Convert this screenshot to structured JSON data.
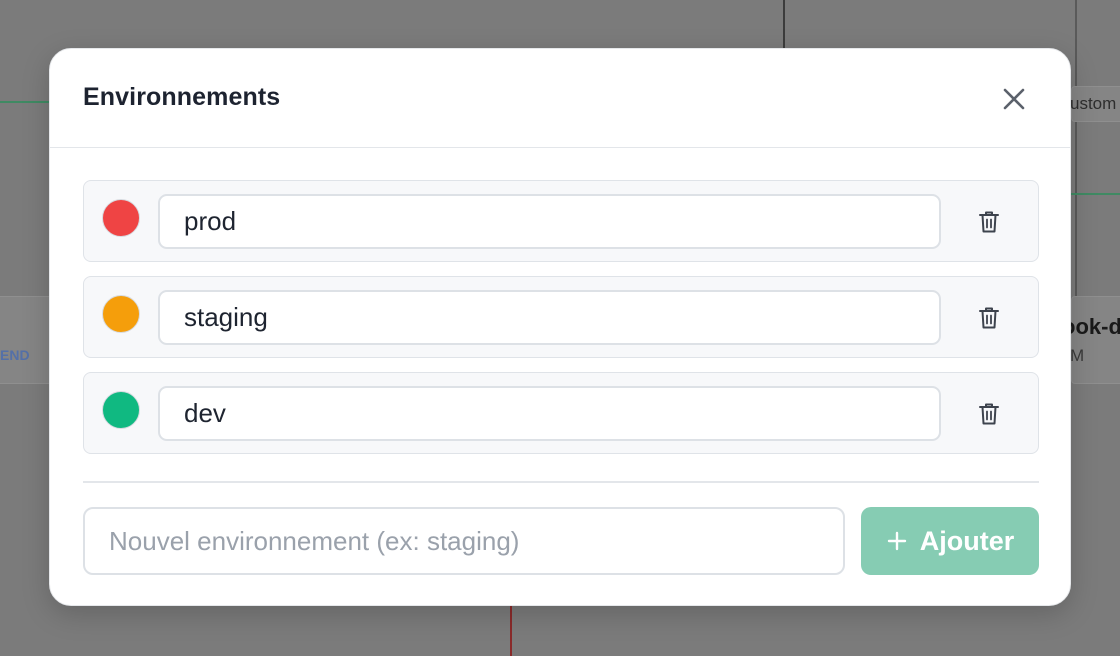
{
  "background": {
    "partial_text_right": "ook-d",
    "partial_text_right_sub": "M",
    "partial_text_left": "END",
    "partial_tab_right": "ustom"
  },
  "modal": {
    "title": "Environnements",
    "close_icon": "close-icon",
    "environments": [
      {
        "name": "prod",
        "color": "#ef4444"
      },
      {
        "name": "staging",
        "color": "#f59e0b"
      },
      {
        "name": "dev",
        "color": "#10b981"
      }
    ],
    "delete_icon": "trash-icon",
    "new_env": {
      "value": "",
      "placeholder": "Nouvel environnement (ex: staging)"
    },
    "add_button": {
      "label": "Ajouter",
      "icon": "plus-icon",
      "color": "#86ccb3"
    }
  }
}
